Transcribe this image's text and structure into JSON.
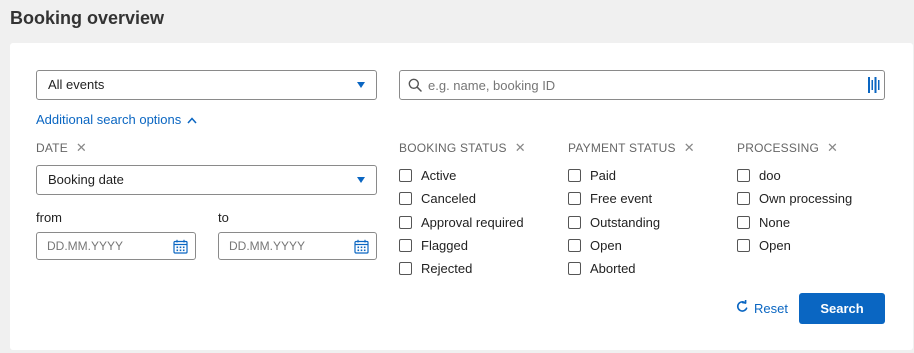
{
  "page": {
    "title": "Booking overview"
  },
  "filters": {
    "event_select": {
      "value": "All events"
    },
    "search": {
      "placeholder": "e.g. name, booking ID"
    },
    "additional_options_label": "Additional search options"
  },
  "date": {
    "heading": "DATE",
    "type_select": {
      "value": "Booking date"
    },
    "from_label": "from",
    "to_label": "to",
    "from_placeholder": "DD.MM.YYYY",
    "to_placeholder": "DD.MM.YYYY"
  },
  "booking_status": {
    "heading": "BOOKING STATUS",
    "options": [
      "Active",
      "Canceled",
      "Approval required",
      "Flagged",
      "Rejected"
    ]
  },
  "payment_status": {
    "heading": "PAYMENT STATUS",
    "options": [
      "Paid",
      "Free event",
      "Outstanding",
      "Open",
      "Aborted"
    ]
  },
  "processing": {
    "heading": "PROCESSING",
    "options": [
      "doo",
      "Own processing",
      "None",
      "Open"
    ]
  },
  "actions": {
    "reset_label": "Reset",
    "search_label": "Search"
  },
  "colors": {
    "accent": "#0a66c2",
    "background": "#f0f0f0",
    "card": "#ffffff"
  },
  "icons": {
    "search": "magnifier-icon",
    "scan": "barcode-scan-icon",
    "calendar": "calendar-icon",
    "reset": "refresh-icon",
    "close": "close-x-icon",
    "dropdown": "triangle-down-icon",
    "expand": "chevron-up-icon"
  }
}
